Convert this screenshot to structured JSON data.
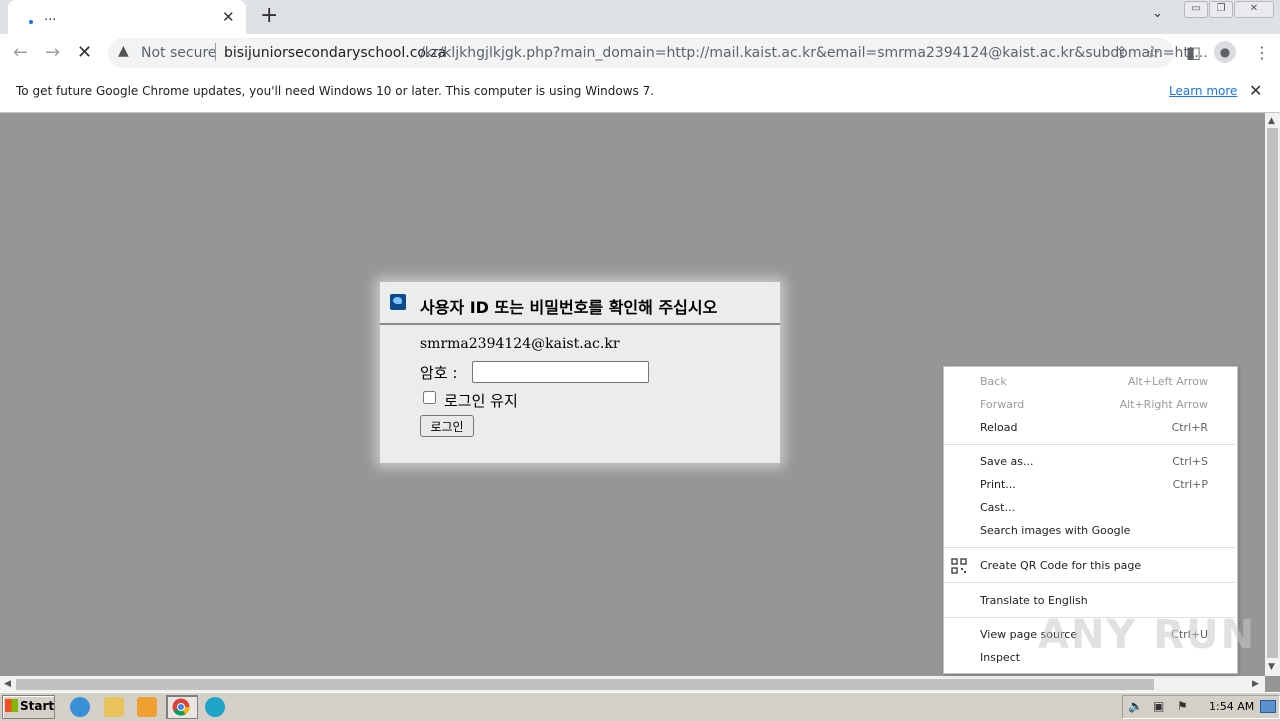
{
  "browser": {
    "tab": {
      "title": "...",
      "close_glyph": "✕"
    },
    "new_tab_glyph": "+",
    "tab_search_glyph": "⌄",
    "window_controls": [
      "▭",
      "❐",
      "✕"
    ],
    "nav": {
      "back_glyph": "←",
      "forward_glyph": "→",
      "stop_glyph": "✕"
    },
    "omnibox": {
      "security_icon": "warning-triangle-icon",
      "security_label": "Not secure",
      "url_host": "bisijuniorsecondaryschool.co.za",
      "url_path": "/kr/kljkhgjlkjgk.php?main_domain=http://mail.kaist.ac.kr&email=smrma2394124@kaist.ac.kr&subdomain=htt..."
    },
    "toolbar_icons": [
      "share-icon",
      "star-icon",
      "side-panel-icon",
      "profile-icon",
      "menu-icon"
    ]
  },
  "infobar": {
    "message": "To get future Google Chrome updates, you'll need Windows 10 or later. This computer is using Windows 7.",
    "link": "Learn more",
    "close_glyph": "✕"
  },
  "dialog": {
    "title": "사용자 ID 또는 비밀번호를 확인해 주십시오",
    "email": "smrma2394124@kaist.ac.kr",
    "password_label": "암호 :",
    "password_value": "",
    "remember_label": "로그인 유지",
    "login_button": "로그인"
  },
  "context_menu": {
    "items": [
      {
        "label": "Back",
        "shortcut": "Alt+Left Arrow",
        "disabled": true
      },
      {
        "label": "Forward",
        "shortcut": "Alt+Right Arrow",
        "disabled": true
      },
      {
        "label": "Reload",
        "shortcut": "Ctrl+R",
        "disabled": false
      },
      {
        "label": "Save as...",
        "shortcut": "Ctrl+S",
        "disabled": false
      },
      {
        "label": "Print...",
        "shortcut": "Ctrl+P",
        "disabled": false
      },
      {
        "label": "Cast...",
        "shortcut": "",
        "disabled": false
      },
      {
        "label": "Search images with Google",
        "shortcut": "",
        "disabled": false
      },
      {
        "label": "Create QR Code for this page",
        "shortcut": "",
        "disabled": false
      },
      {
        "label": "Translate to English",
        "shortcut": "",
        "disabled": false
      },
      {
        "label": "View page source",
        "shortcut": "Ctrl+U",
        "disabled": false
      },
      {
        "label": "Inspect",
        "shortcut": "",
        "disabled": false
      }
    ]
  },
  "watermark": "ANY RUN",
  "taskbar": {
    "start_label": "Start",
    "apps": [
      "internet-explorer-icon",
      "file-explorer-icon",
      "media-player-icon",
      "chrome-icon",
      "edge-icon"
    ],
    "clock": "1:54 AM"
  },
  "colors": {
    "page_bg": "#969696",
    "link": "#1a73e8",
    "dialog_bg": "#ececec"
  }
}
